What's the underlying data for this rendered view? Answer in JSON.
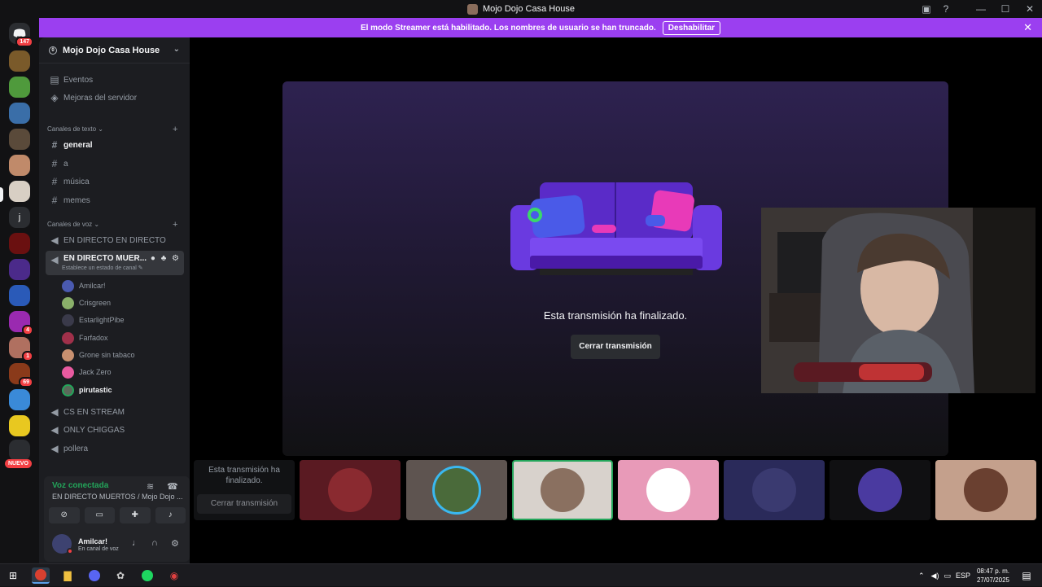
{
  "window": {
    "title": "Mojo Dojo Casa House"
  },
  "banner": {
    "text": "El modo Streamer está habilitado. Los nombres de usuario se han truncado.",
    "button": "Deshabilitar"
  },
  "servers": {
    "home_badge": "147",
    "badges": [
      "4",
      "1",
      "69"
    ],
    "new_label": "NUEVO"
  },
  "server": {
    "name": "Mojo Dojo Casa House"
  },
  "menu": {
    "events": "Eventos",
    "boosts": "Mejoras del servidor"
  },
  "text_category": "Canales de texto",
  "text_channels": [
    "general",
    "a",
    "música",
    "memes"
  ],
  "voice_category": "Canales de voz",
  "voice_channels": {
    "first": "EN DIRECTO EN DIRECTO",
    "active": "EN DIRECTO MUER...",
    "active_status": "Establece un estado de canal",
    "rest": [
      "CS EN STREAM",
      "ONLY CHIGGAS",
      "pollera"
    ]
  },
  "voice_users": [
    "Amilcar!",
    "Crisgreen",
    "EstarlightPibe",
    "Farfadox",
    "Grone sin tabaco",
    "Jack Zero",
    "pirutastic"
  ],
  "voice_panel": {
    "title": "Voz conectada",
    "subtitle": "EN DIRECTO MUERTOS / Mojo Dojo ..."
  },
  "me": {
    "name": "Amilcar!",
    "status": "En canal de voz"
  },
  "stage": {
    "ended_text": "Esta transmisión ha finalizado.",
    "close_button": "Cerrar transmisión"
  },
  "tiles": {
    "first_text": "Esta transmisión ha finalizado.",
    "first_button": "Cerrar transmisión"
  },
  "taskbar": {
    "lang": "ESP",
    "time": "08:47 p. m.",
    "date": "27/07/2025"
  },
  "colors": {
    "accent": "#9b3ff0",
    "voice_green": "#23a55a",
    "danger": "#f23f43"
  }
}
